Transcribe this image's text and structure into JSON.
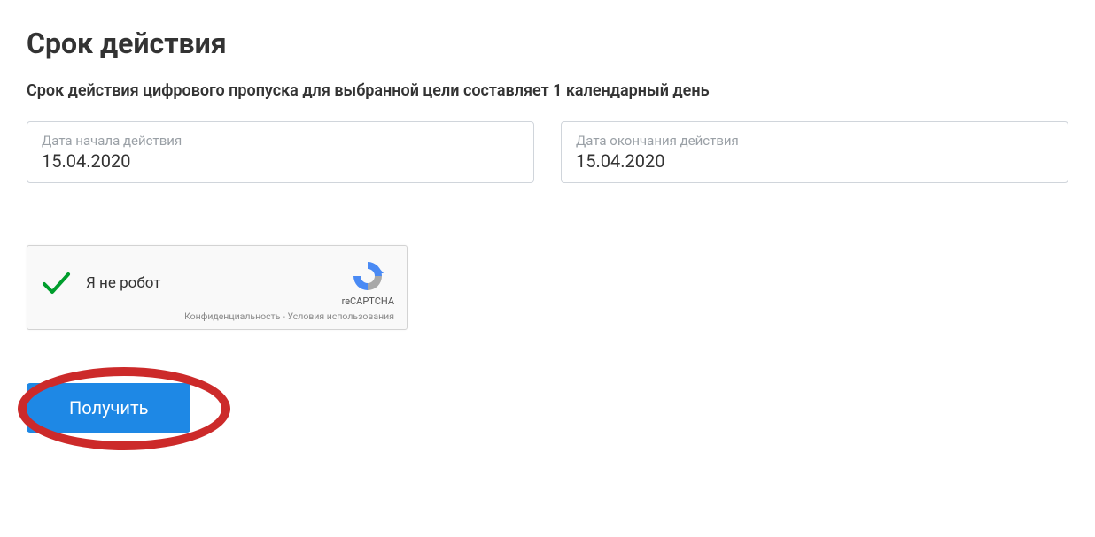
{
  "title": "Срок действия",
  "description": "Срок действия цифрового пропуска для выбранной цели составляет 1 календарный день",
  "startDate": {
    "label": "Дата начала действия",
    "value": "15.04.2020"
  },
  "endDate": {
    "label": "Дата окончания действия",
    "value": "15.04.2020"
  },
  "recaptcha": {
    "label": "Я не робот",
    "brand": "reCAPTCHA",
    "privacy": "Конфиденциальность",
    "separator": " - ",
    "terms": "Условия использования"
  },
  "submit": {
    "label": "Получить"
  }
}
